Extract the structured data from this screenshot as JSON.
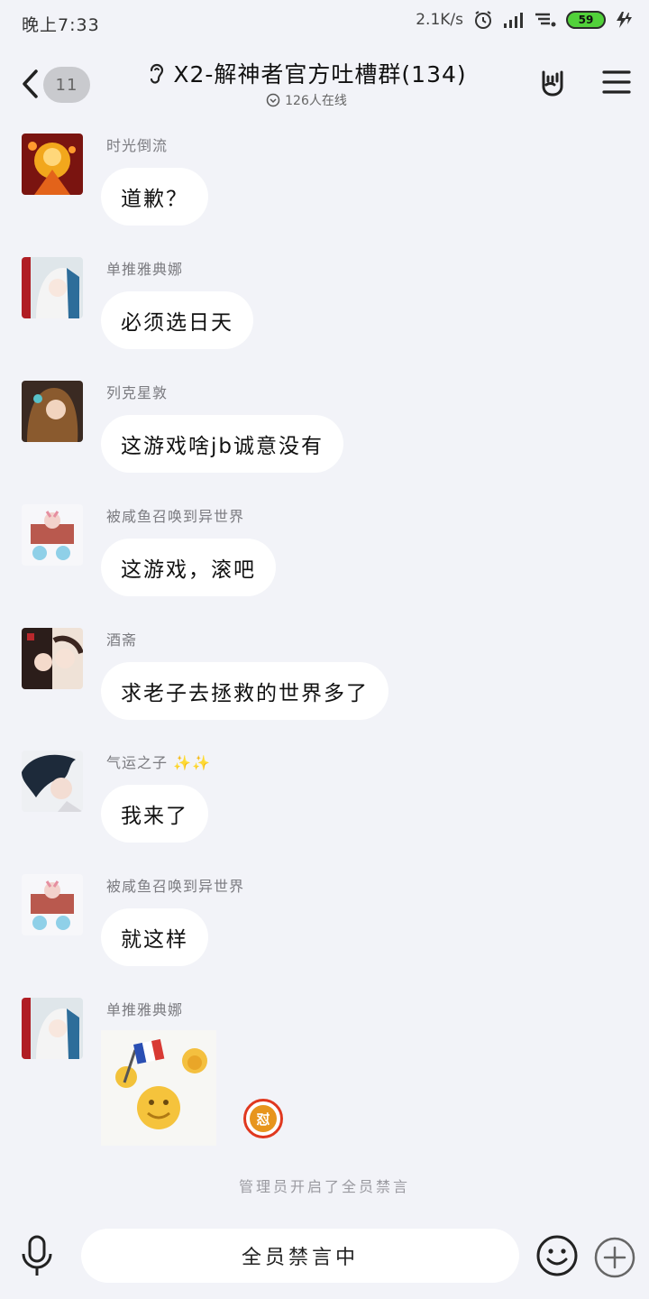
{
  "status_bar": {
    "time": "晚上7:33",
    "net_speed": "2.1K/s",
    "battery": "59",
    "battery_color": "#51d13a"
  },
  "header": {
    "unread_count": "11",
    "title": "X2-解神者官方吐槽群(134)",
    "online": "126人在线",
    "icons": [
      "back-icon",
      "ear-icon",
      "rock-hand-icon",
      "menu-icon"
    ]
  },
  "messages": [
    {
      "sender": "时光倒流",
      "text": "道歉？",
      "avatar": "avatar-fiery-character"
    },
    {
      "sender": "单推雅典娜",
      "text": "必须选日天",
      "avatar": "avatar-white-haired-girl"
    },
    {
      "sender": "列克星敦",
      "text": "这游戏啥jb诚意没有",
      "avatar": "avatar-brown-haired-girl"
    },
    {
      "sender": "被咸鱼召唤到异世界",
      "text": "这游戏，滚吧",
      "avatar": "avatar-chibi-character"
    },
    {
      "sender": "酒斋",
      "text": "求老子去拯救的世界多了",
      "avatar": "avatar-two-characters"
    },
    {
      "sender": "气运之子",
      "sender_suffix": "✨✨",
      "text": "我来了",
      "avatar": "avatar-dark-haired-character"
    },
    {
      "sender": "被咸鱼召唤到异世界",
      "text": "就这样",
      "avatar": "avatar-chibi-character"
    },
    {
      "sender": "单推雅典娜",
      "sticker": "french-flag-emoji-sticker",
      "badge": "怼",
      "avatar": "avatar-white-haired-girl"
    }
  ],
  "system_notice": "管理员开启了全员禁言",
  "input": {
    "muted_text": "全员禁言中",
    "icons": [
      "mic-icon",
      "smile-icon",
      "plus-icon"
    ]
  },
  "colors": {
    "background": "#f2f3f8",
    "bubble": "#ffffff",
    "badge_ring": "#e0381f",
    "badge_fill": "#e7951d"
  }
}
